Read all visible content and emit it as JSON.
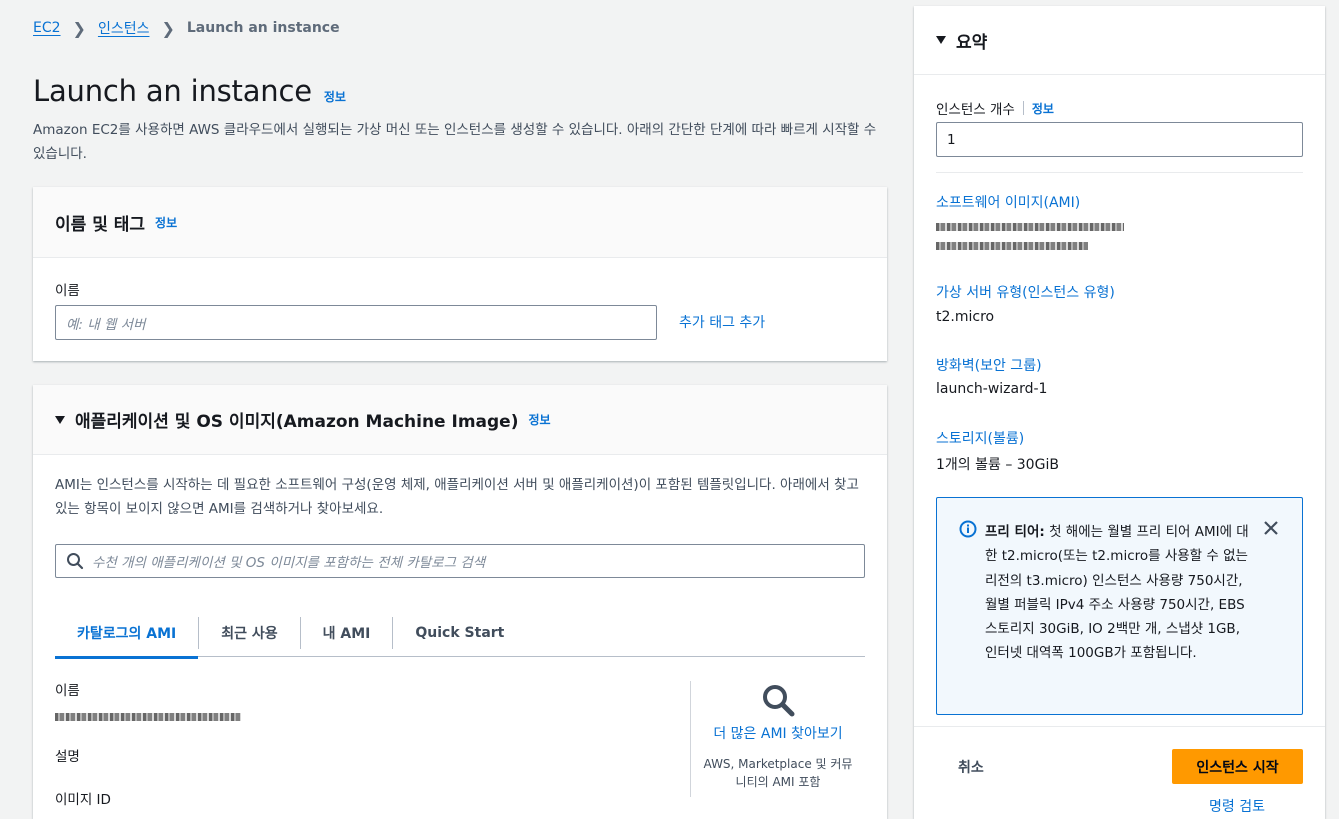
{
  "breadcrumb": {
    "items": [
      "EC2",
      "인스턴스"
    ],
    "current": "Launch an instance"
  },
  "page": {
    "title": "Launch an instance",
    "info": "정보",
    "description": "Amazon EC2를 사용하면 AWS 클라우드에서 실행되는 가상 머신 또는 인스턴스를 생성할 수 있습니다. 아래의 간단한 단계에 따라 빠르게 시작할 수 있습니다."
  },
  "name_tags": {
    "title": "이름 및 태그",
    "info": "정보",
    "name_label": "이름",
    "name_placeholder": "예: 내 웹 서버",
    "add_tags": "추가 태그 추가"
  },
  "ami": {
    "title": "애플리케이션 및 OS 이미지(Amazon Machine Image)",
    "info": "정보",
    "description": "AMI는 인스턴스를 시작하는 데 필요한 소프트웨어 구성(운영 체제, 애플리케이션 서버 및 애플리케이션)이 포함된 템플릿입니다. 아래에서 찾고 있는 항목이 보이지 않으면 AMI를 검색하거나 찾아보세요.",
    "search_placeholder": "수천 개의 애플리케이션 및 OS 이미지를 포함하는 전체 카탈로그 검색",
    "tabs": [
      "카탈로그의 AMI",
      "최근 사용",
      "내 AMI",
      "Quick Start"
    ],
    "active_tab": "카탈로그의 AMI",
    "name_label": "이름",
    "desc_label": "설명",
    "image_id_label": "이미지 ID",
    "more_amis": "더 많은 AMI 찾아보기",
    "more_amis_sub": "AWS, Marketplace 및 커뮤니티의 AMI 포함"
  },
  "summary": {
    "title": "요약",
    "instance_count_label": "인스턴스 개수",
    "info": "정보",
    "instance_count_value": "1",
    "software_image_label": "소프트웨어 이미지(AMI)",
    "instance_type_label": "가상 서버 유형(인스턴스 유형)",
    "instance_type_value": "t2.micro",
    "firewall_label": "방화벽(보안 그룹)",
    "firewall_value": "launch-wizard-1",
    "storage_label": "스토리지(볼륨)",
    "storage_value": "1개의 볼륨 – 30GiB",
    "free_tier_title": "프리 티어:",
    "free_tier_text": "첫 해에는 월별 프리 티어 AMI에 대한 t2.micro(또는 t2.micro를 사용할 수 없는 리전의 t3.micro) 인스턴스 사용량 750시간, 월별 퍼블릭 IPv4 주소 사용량 750시간, EBS 스토리지 30GiB, IO 2백만 개, 스냅샷 1GB, 인터넷 대역폭 100GB가 포함됩니다.",
    "cancel": "취소",
    "launch": "인스턴스 시작",
    "review_commands": "명령 검토"
  }
}
